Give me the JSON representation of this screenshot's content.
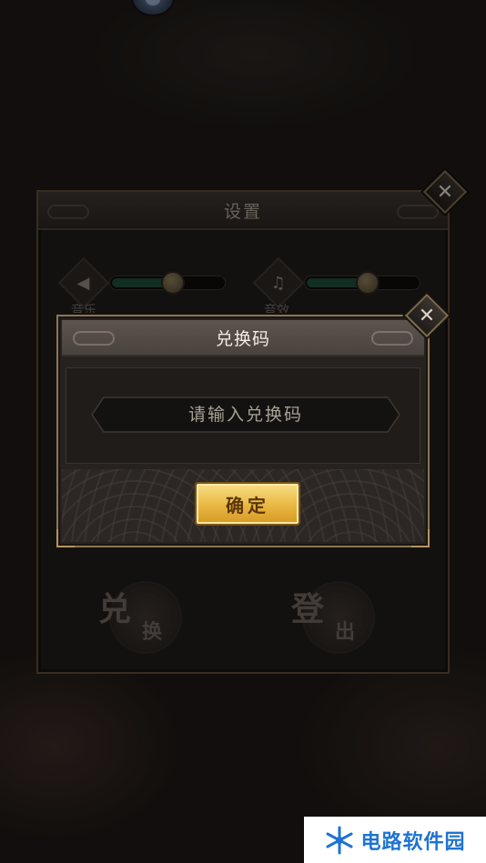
{
  "settings_panel": {
    "title": "设置",
    "music_label": "音乐",
    "music_level": 0.54,
    "sfx_label": "音效",
    "sfx_level": 0.54,
    "redeem_button_main": "兑",
    "redeem_button_sub": "换",
    "logout_button_main": "登",
    "logout_button_sub": "出",
    "close_glyph": "✕"
  },
  "redeem_dialog": {
    "title": "兑换码",
    "input_placeholder": "请输入兑换码",
    "input_value": "",
    "confirm_label": "确定",
    "close_glyph": "✕"
  },
  "watermark": {
    "text": "电路软件园"
  },
  "colors": {
    "accent_gold": "#e9b742",
    "slider_fill": "#1e4a36",
    "watermark_blue": "#1e73d2"
  }
}
